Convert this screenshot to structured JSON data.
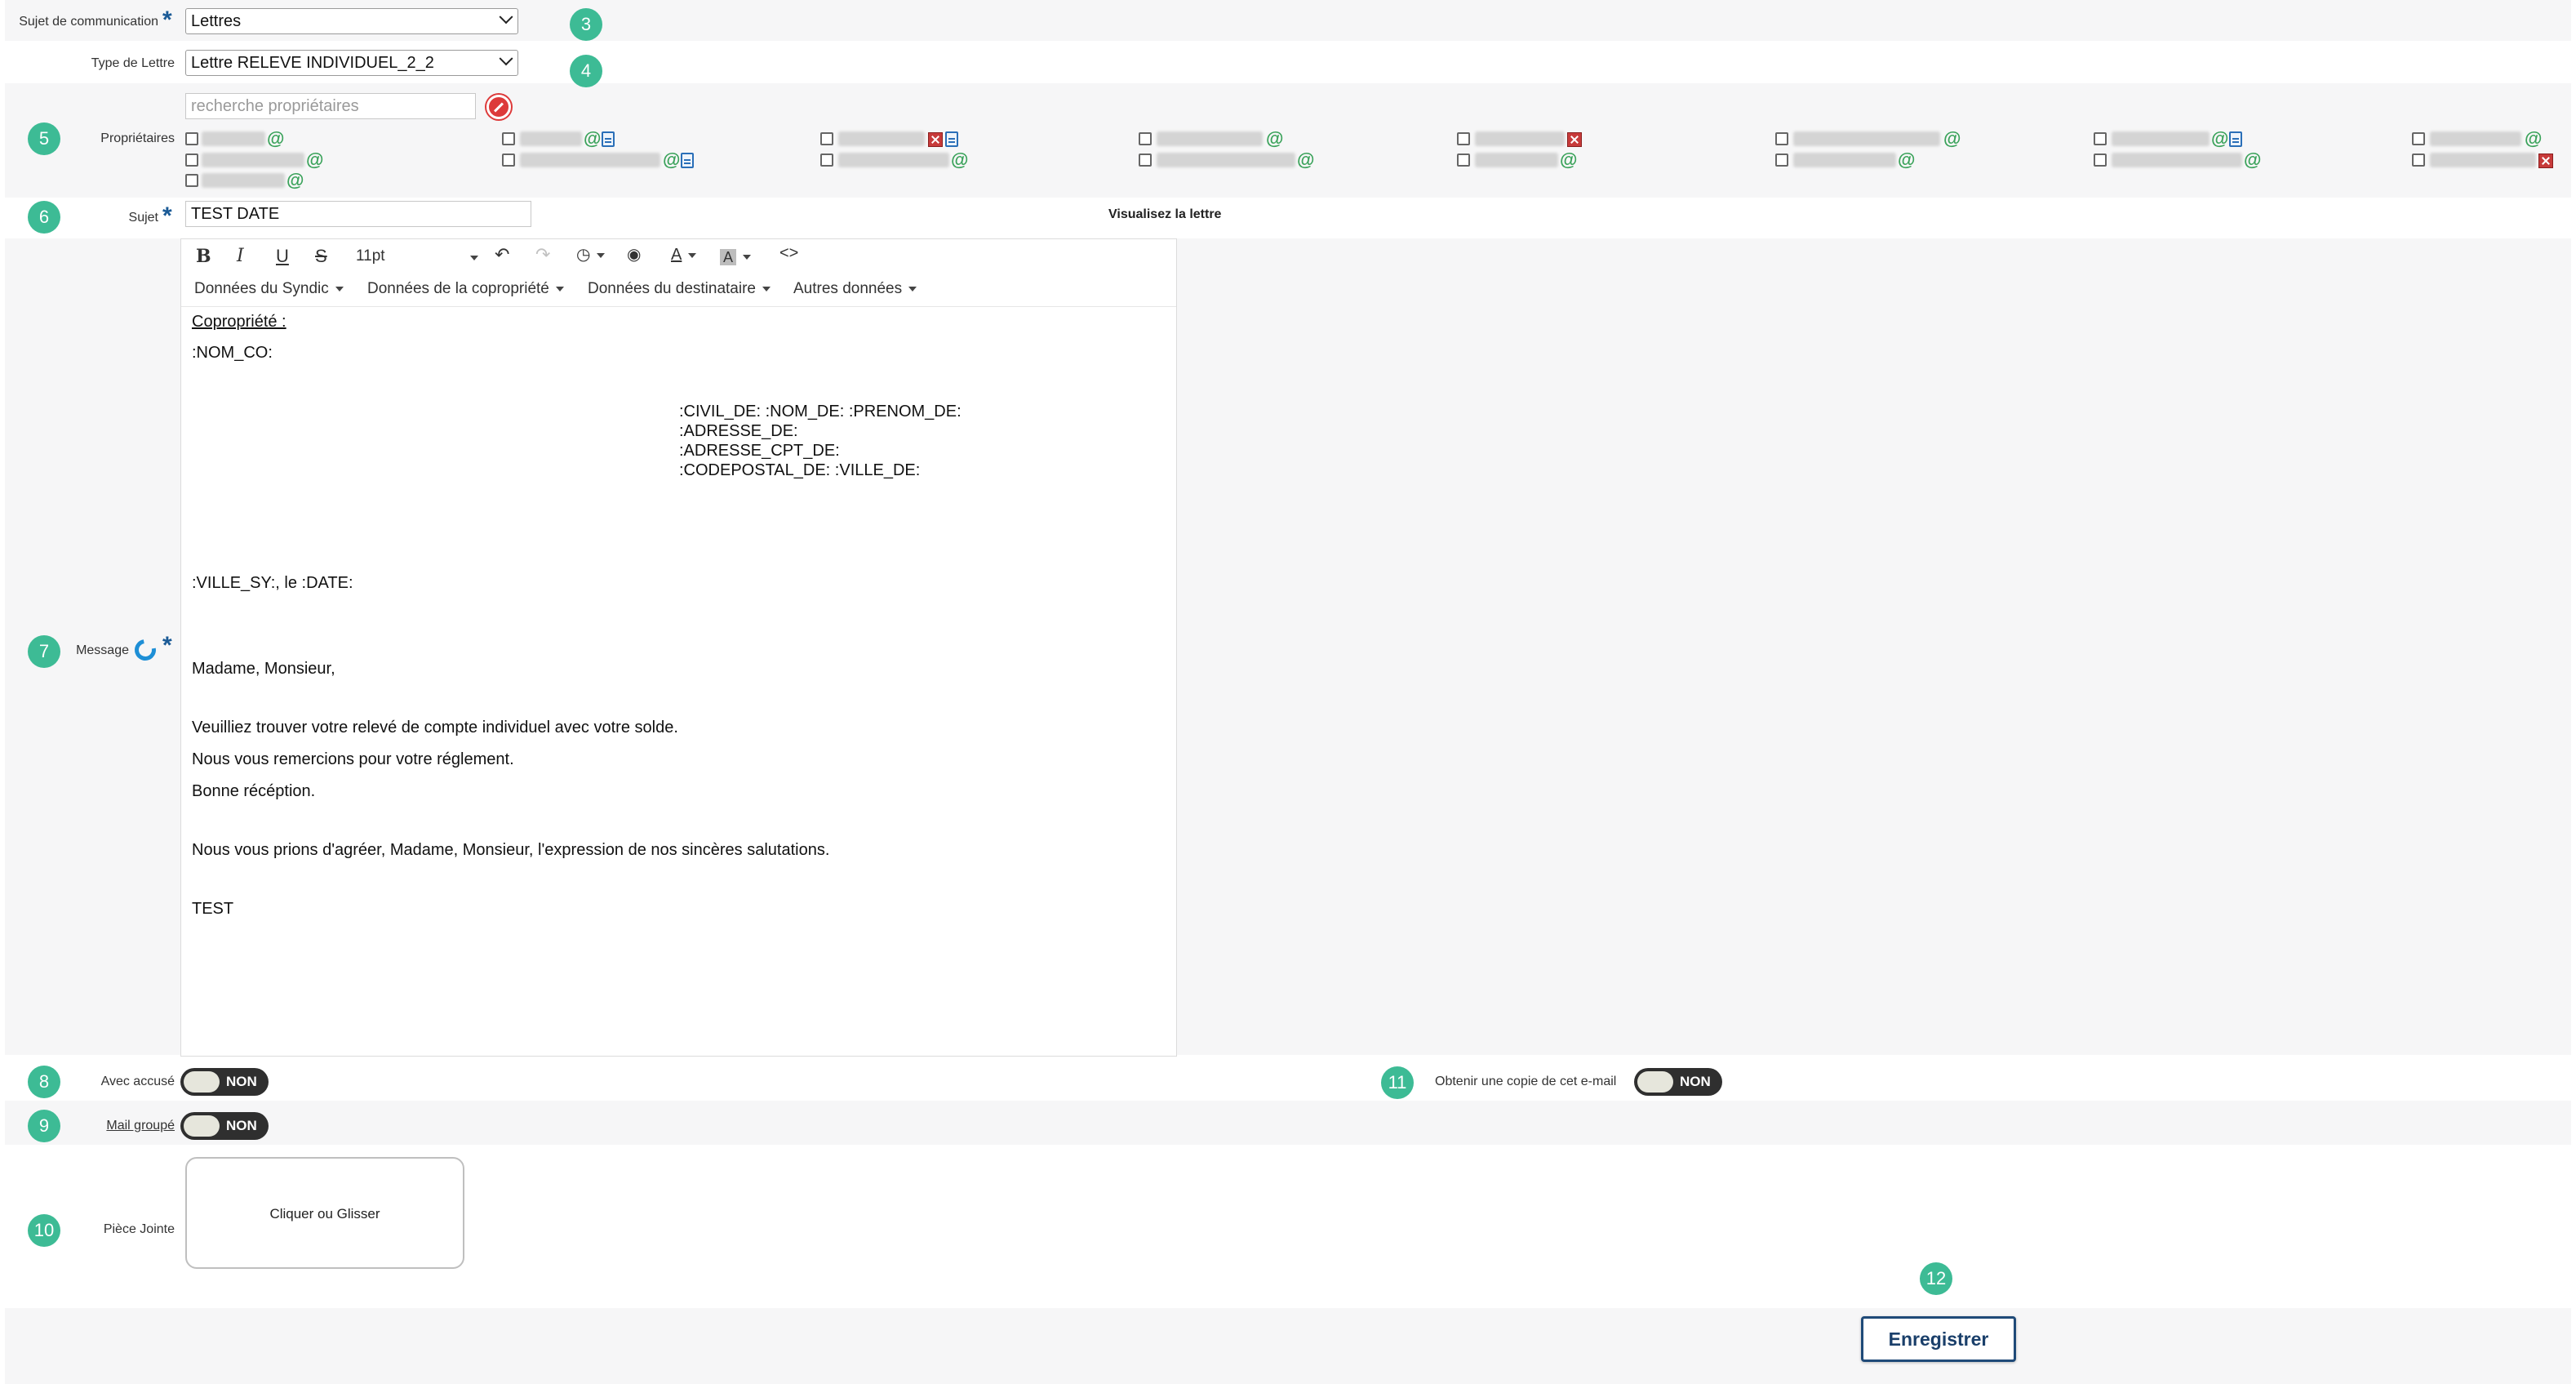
{
  "colors": {
    "accent": "#3dbb95",
    "required": "#1a5a96",
    "save_border": "#1f4a78",
    "at_green": "#3aa25a"
  },
  "fields": {
    "sujet_communication": {
      "label": "Sujet de communication",
      "value": "Lettres",
      "badge": "3"
    },
    "type_lettre": {
      "label": "Type de Lettre",
      "value": "Lettre RELEVE INDIVIDUEL_2_2",
      "badge": "4"
    },
    "proprietaires": {
      "label": "Propriétaires",
      "search_placeholder": "recherche propriétaires",
      "badge": "5"
    },
    "sujet": {
      "label": "Sujet",
      "value": "TEST DATE",
      "badge": "6",
      "preview_link": "Visualisez la lettre"
    },
    "message": {
      "label": "Message",
      "badge": "7"
    },
    "avec_accuse": {
      "label": "Avec accusé",
      "toggle": "NON",
      "badge": "8"
    },
    "mail_groupe": {
      "label": "Mail groupé",
      "toggle": "NON",
      "badge": "9"
    },
    "piece_jointe": {
      "label": "Pièce Jointe",
      "dropzone": "Cliquer ou Glisser",
      "badge": "10"
    },
    "copie_email": {
      "label": "Obtenir une copie de cet e-mail",
      "toggle": "NON",
      "badge": "11"
    },
    "save": {
      "label": "Enregistrer",
      "badge": "12"
    }
  },
  "editor": {
    "font_size": "11pt",
    "menus": [
      "Données du Syndic",
      "Données de la copropriété",
      "Données du destinataire",
      "Autres données"
    ],
    "content": {
      "heading": "Copropriété :",
      "nom_co": ":NOM_CO:",
      "addr1": ":CIVIL_DE: :NOM_DE: :PRENOM_DE:",
      "addr2": ":ADRESSE_DE:",
      "addr3": ":ADRESSE_CPT_DE:",
      "addr4": ":CODEPOSTAL_DE: :VILLE_DE:",
      "date_line": ":VILLE_SY:, le :DATE:",
      "greeting": "Madame, Monsieur,",
      "p1": "Veuilliez trouver votre relevé de compte individuel avec votre solde.",
      "p2": "Nous vous remercions pour votre réglement.",
      "p3": "Bonne récéption.",
      "p4": "Nous vous prions d'agréer, Madame, Monsieur, l'expression de nos sincères salutations.",
      "sign": "TEST"
    }
  },
  "icons": [
    "clear-search-icon",
    "email-at-icon",
    "document-icon",
    "no-document-icon",
    "bold-icon",
    "italic-icon",
    "underline-icon",
    "strikethrough-icon",
    "undo-icon",
    "redo-icon",
    "clock-icon",
    "preview-eye-icon",
    "text-color-icon",
    "highlight-color-icon",
    "source-code-icon",
    "refresh-icon"
  ]
}
